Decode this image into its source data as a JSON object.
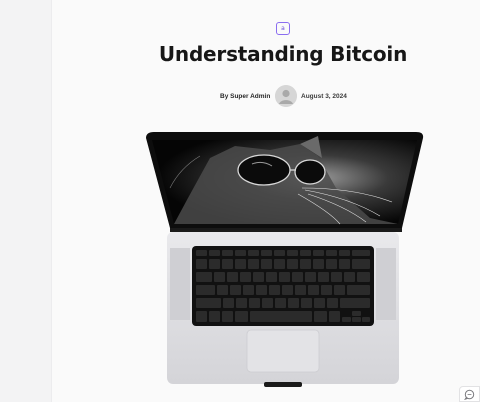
{
  "post": {
    "category_tag": "a",
    "title": "Understanding Bitcoin",
    "author": "By Super Admin",
    "date": "August 3, 2024"
  },
  "icons": {
    "avatar": "user-avatar-icon",
    "chat": "chat-bubble-icon"
  },
  "colors": {
    "accent": "#8a6df0",
    "title": "#171717",
    "background": "#fafafa"
  }
}
